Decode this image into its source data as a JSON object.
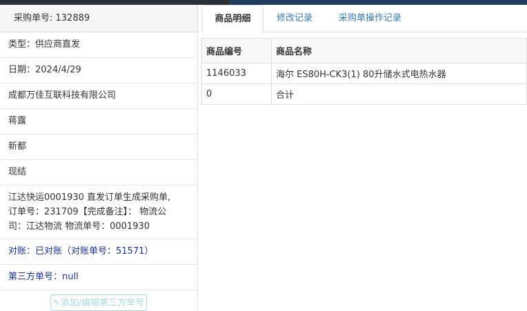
{
  "left": {
    "header": "采购单号: 132889",
    "type": "类型：供应商直发",
    "date": "日期：2024/4/29",
    "company": "成都万佳互联科技有限公司",
    "person": "蒋露",
    "city": "新都",
    "payment": "现结",
    "note_line1": "江达快运0001930 直发订单生成采购单,",
    "note_line2": "订单号：231709【完成备注】： 物流公",
    "note_line3": "司：江达物流 物流单号：0001930",
    "reconcile": "对账：已对账（对账单号：51571）",
    "third_party": "第三方单号：null",
    "add_button": "添加/编辑第三方单号"
  },
  "tabs": [
    "商品明细",
    "修改记录",
    "采购单操作记录"
  ],
  "table": {
    "headers": [
      "商品编号",
      "商品名称"
    ],
    "rows": [
      [
        "1146033",
        "海尔 ES80H-CK3(1) 80升储水式电热水器"
      ],
      [
        "0",
        "合计"
      ]
    ]
  },
  "colors": {
    "link_blue": "#337ab7",
    "reconcile_blue": "#1a2fa0",
    "disabled_button": "#a8dadf"
  }
}
